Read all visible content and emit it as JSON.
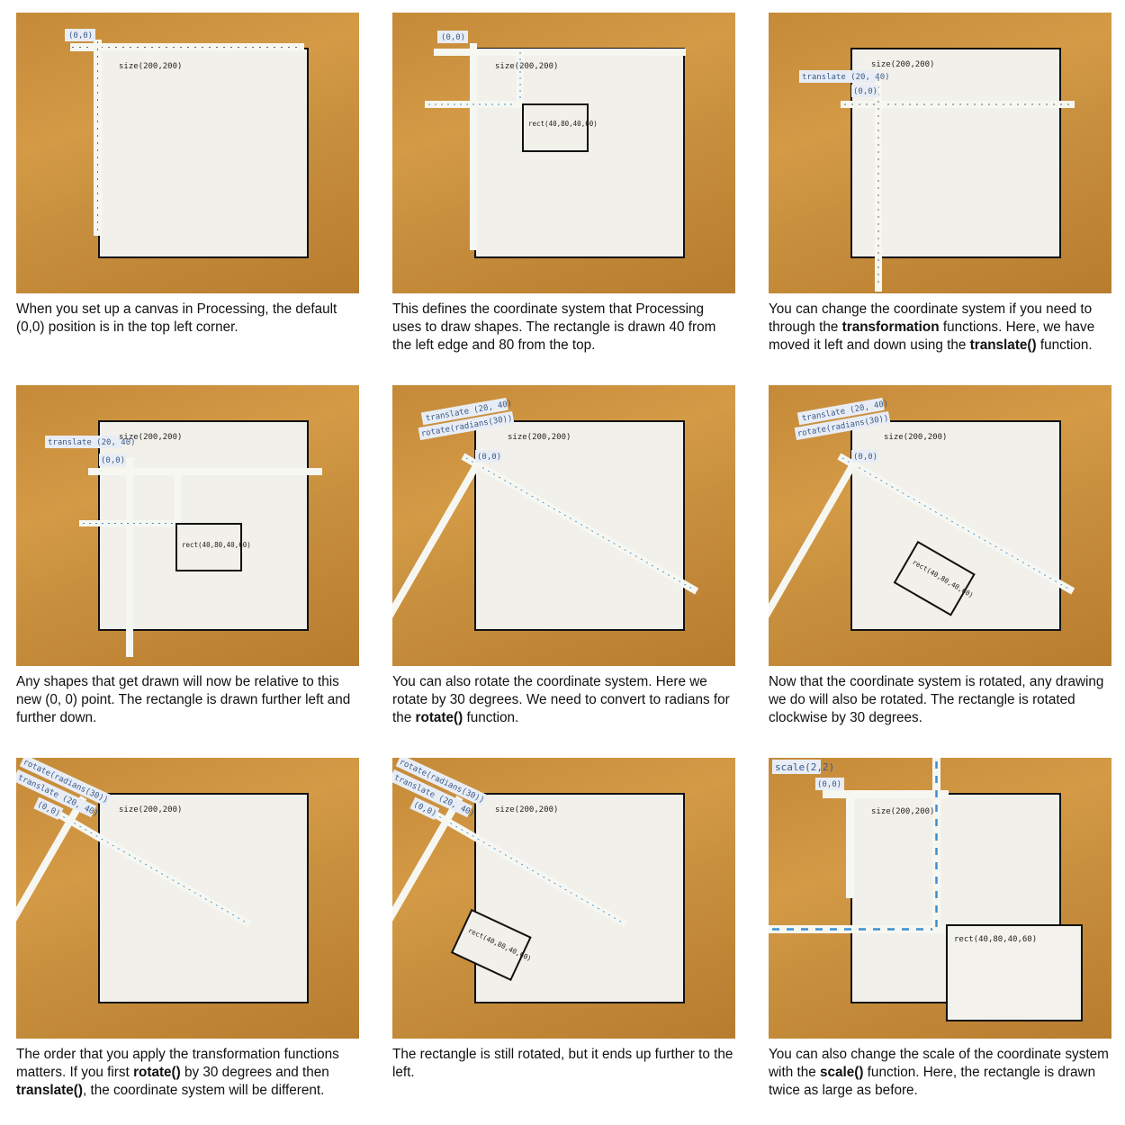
{
  "colors": {
    "wood": "#c8903e",
    "paper": "#f2f0ea",
    "line": "#111111",
    "tape": "#f7f7f2",
    "dash_blue": "#3b8fd0"
  },
  "panels": [
    {
      "labels": {
        "origin": "(0,0)",
        "size": "size(200,200)"
      },
      "caption": [
        {
          "t": "When you set up a canvas in Processing, the default (0,0) position is in the top left corner.",
          "b": false
        }
      ]
    },
    {
      "labels": {
        "origin": "(0,0)",
        "size": "size(200,200)",
        "rect": "rect(40,80,40,60)"
      },
      "caption": [
        {
          "t": "This defines the coordinate system that Processing uses to draw shapes. The rectangle is drawn 40 from the left edge and 80 from the top.",
          "b": false
        }
      ]
    },
    {
      "labels": {
        "translate": "translate (20, 40)",
        "origin": "(0,0)",
        "size": "size(200,200)"
      },
      "caption": [
        {
          "t": "You can change the coordinate system if you need to through the ",
          "b": false
        },
        {
          "t": "transformation",
          "b": true
        },
        {
          "t": " functions. Here, we have moved it left and down using the ",
          "b": false
        },
        {
          "t": "translate()",
          "b": true
        },
        {
          "t": " function.",
          "b": false
        }
      ]
    },
    {
      "labels": {
        "translate": "translate (20, 40)",
        "origin": "(0,0)",
        "size": "size(200,200)",
        "rect": "rect(40,80,40,60)"
      },
      "caption": [
        {
          "t": "Any shapes that get drawn will now be relative to this new (0, 0) point. The rectangle is drawn further left and further down.",
          "b": false
        }
      ]
    },
    {
      "labels": {
        "translate": "translate (20, 40)",
        "rotate": "rotate(radians(30))",
        "origin": "(0,0)",
        "size": "size(200,200)"
      },
      "caption": [
        {
          "t": "You can also rotate the coordinate system. Here we rotate by 30 degrees. We need to convert to radians for the ",
          "b": false
        },
        {
          "t": "rotate()",
          "b": true
        },
        {
          "t": " function.",
          "b": false
        }
      ]
    },
    {
      "labels": {
        "translate": "translate (20, 40)",
        "rotate": "rotate(radians(30))",
        "origin": "(0,0)",
        "size": "size(200,200)",
        "rect": "rect(40,80,40,60)"
      },
      "caption": [
        {
          "t": "Now that the coordinate system is rotated, any drawing we do will also be rotated. The rectangle is rotated clockwise by 30 degrees.",
          "b": false
        }
      ]
    },
    {
      "labels": {
        "rotate": "rotate(radians(30))",
        "translate": "translate (20, 40)",
        "origin": "(0,0)",
        "size": "size(200,200)"
      },
      "caption": [
        {
          "t": "The order that you apply the transformation functions matters. If you first ",
          "b": false
        },
        {
          "t": "rotate()",
          "b": true
        },
        {
          "t": " by 30 degrees and then ",
          "b": false
        },
        {
          "t": "translate()",
          "b": true
        },
        {
          "t": ", the coordinate system will be different.",
          "b": false
        }
      ]
    },
    {
      "labels": {
        "rotate": "rotate(radians(30))",
        "translate": "translate (20, 40)",
        "origin": "(0,0)",
        "size": "size(200,200)",
        "rect": "rect(40,80,40,60)"
      },
      "caption": [
        {
          "t": "The rectangle is still rotated, but it ends up further to the left.",
          "b": false
        }
      ]
    },
    {
      "labels": {
        "scale": "scale(2,2)",
        "origin": "(0,0)",
        "size": "size(200,200)",
        "rect": "rect(40,80,40,60)"
      },
      "caption": [
        {
          "t": "You can also change the scale of the coordinate system with the ",
          "b": false
        },
        {
          "t": "scale()",
          "b": true
        },
        {
          "t": " function. Here, the rectangle is drawn twice as large as before.",
          "b": false
        }
      ]
    }
  ]
}
